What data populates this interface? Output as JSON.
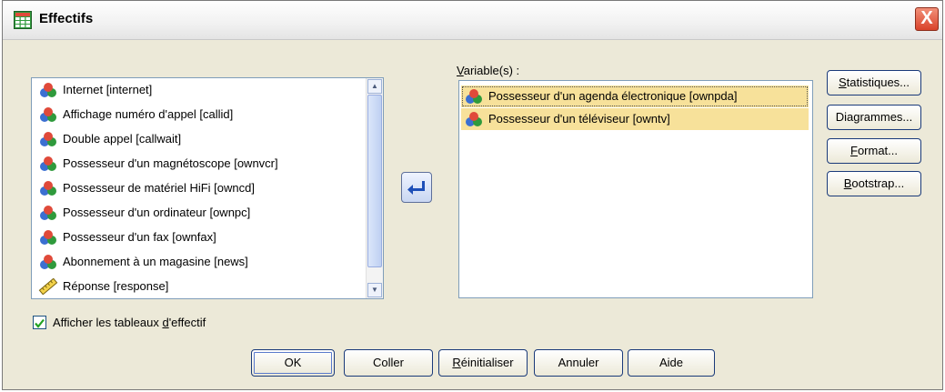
{
  "dialog": {
    "title": "Effectifs",
    "close_label": "X"
  },
  "source_list": {
    "items": [
      {
        "label": "Internet [internet]",
        "icon": "nominal-variable-icon"
      },
      {
        "label": "Affichage numéro d'appel [callid]",
        "icon": "nominal-variable-icon"
      },
      {
        "label": "Double appel [callwait]",
        "icon": "nominal-variable-icon"
      },
      {
        "label": "Possesseur d'un magnétoscope [ownvcr]",
        "icon": "nominal-variable-icon"
      },
      {
        "label": "Possesseur de matériel HiFi [owncd]",
        "icon": "nominal-variable-icon"
      },
      {
        "label": "Possesseur d'un ordinateur [ownpc]",
        "icon": "nominal-variable-icon"
      },
      {
        "label": "Possesseur d'un fax [ownfax]",
        "icon": "nominal-variable-icon"
      },
      {
        "label": "Abonnement à un magasine [news]",
        "icon": "nominal-variable-icon"
      },
      {
        "label": "Réponse [response]",
        "icon": "scale-variable-icon"
      }
    ]
  },
  "variables": {
    "label_prefix": "V",
    "label_rest": "ariable(s) :",
    "items": [
      {
        "label": "Possesseur d'un agenda électronique [ownpda]",
        "icon": "nominal-variable-icon"
      },
      {
        "label": "Possesseur  d'un téléviseur [owntv]",
        "icon": "nominal-variable-icon"
      }
    ]
  },
  "side_buttons": {
    "statistiques": {
      "u": "S",
      "rest": "tatistiques..."
    },
    "diagrammes": {
      "u": "",
      "rest": "Diagrammes..."
    },
    "format": {
      "u": "F",
      "rest": "ormat..."
    },
    "bootstrap": {
      "u": "B",
      "rest": "ootstrap..."
    }
  },
  "checkbox": {
    "label_pre": "Afficher les tableaux ",
    "label_u": "d",
    "label_post": "'effectif",
    "checked": true
  },
  "bottom_buttons": {
    "ok": "OK",
    "coller": "Coller",
    "reinit_u": "R",
    "reinit_rest": "éinitialiser",
    "annuler": "Annuler",
    "aide": "Aide"
  },
  "colors": {
    "dialog_bg": "#ece9d8",
    "selected_item_bg": "#f7e19a",
    "close_button": "#d9422a"
  }
}
